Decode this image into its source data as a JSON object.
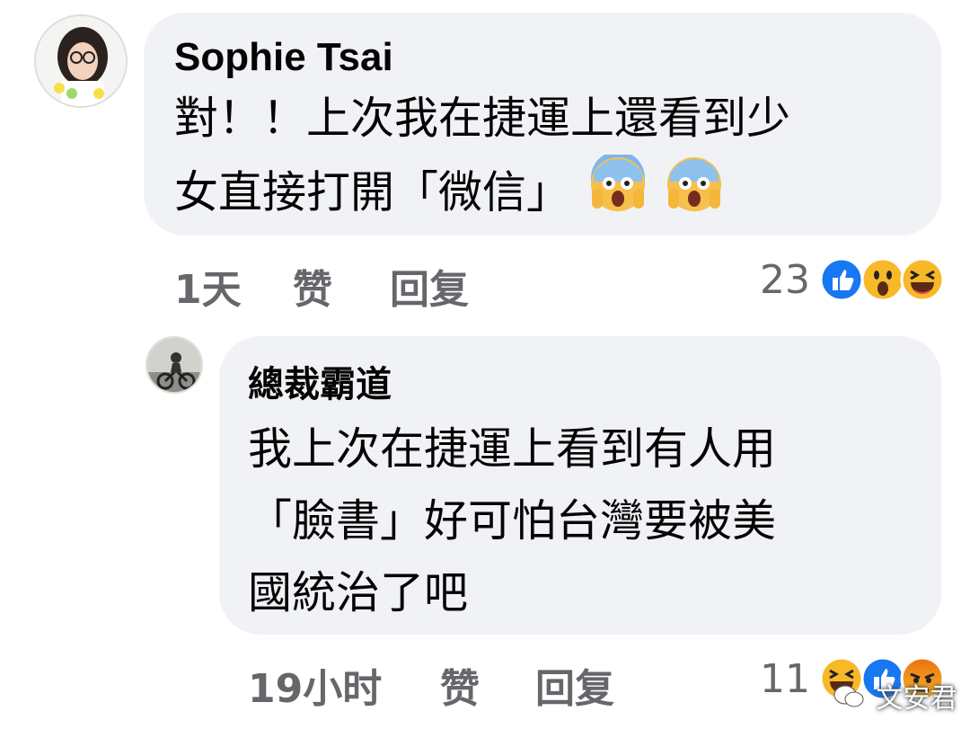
{
  "comment1": {
    "author": "Sophie Tsai",
    "line1": "對！！上次我在捷運上還看到少",
    "line2": "女直接打開「微信」",
    "emoji": [
      "scream-emoji",
      "scream-emoji"
    ],
    "time": "1天",
    "like_label": "赞",
    "reply_label": "回复",
    "reaction_count": "23",
    "reactions": [
      "like-reaction-icon",
      "wow-reaction-icon",
      "haha-reaction-icon"
    ]
  },
  "comment2": {
    "author": "總裁霸道",
    "line1": "我上次在捷運上看到有人用",
    "line2": "「臉書」好可怕台灣要被美",
    "line3": "國統治了吧",
    "time": "19小时",
    "like_label": "赞",
    "reply_label": "回复",
    "reaction_count": "11",
    "reactions": [
      "haha-reaction-icon",
      "like-reaction-icon",
      "angry-reaction-icon"
    ]
  },
  "watermark": {
    "text": "文安君"
  },
  "colors": {
    "bubble": "#f0f2f5",
    "meta": "#65676b",
    "like": "#1877f2"
  }
}
